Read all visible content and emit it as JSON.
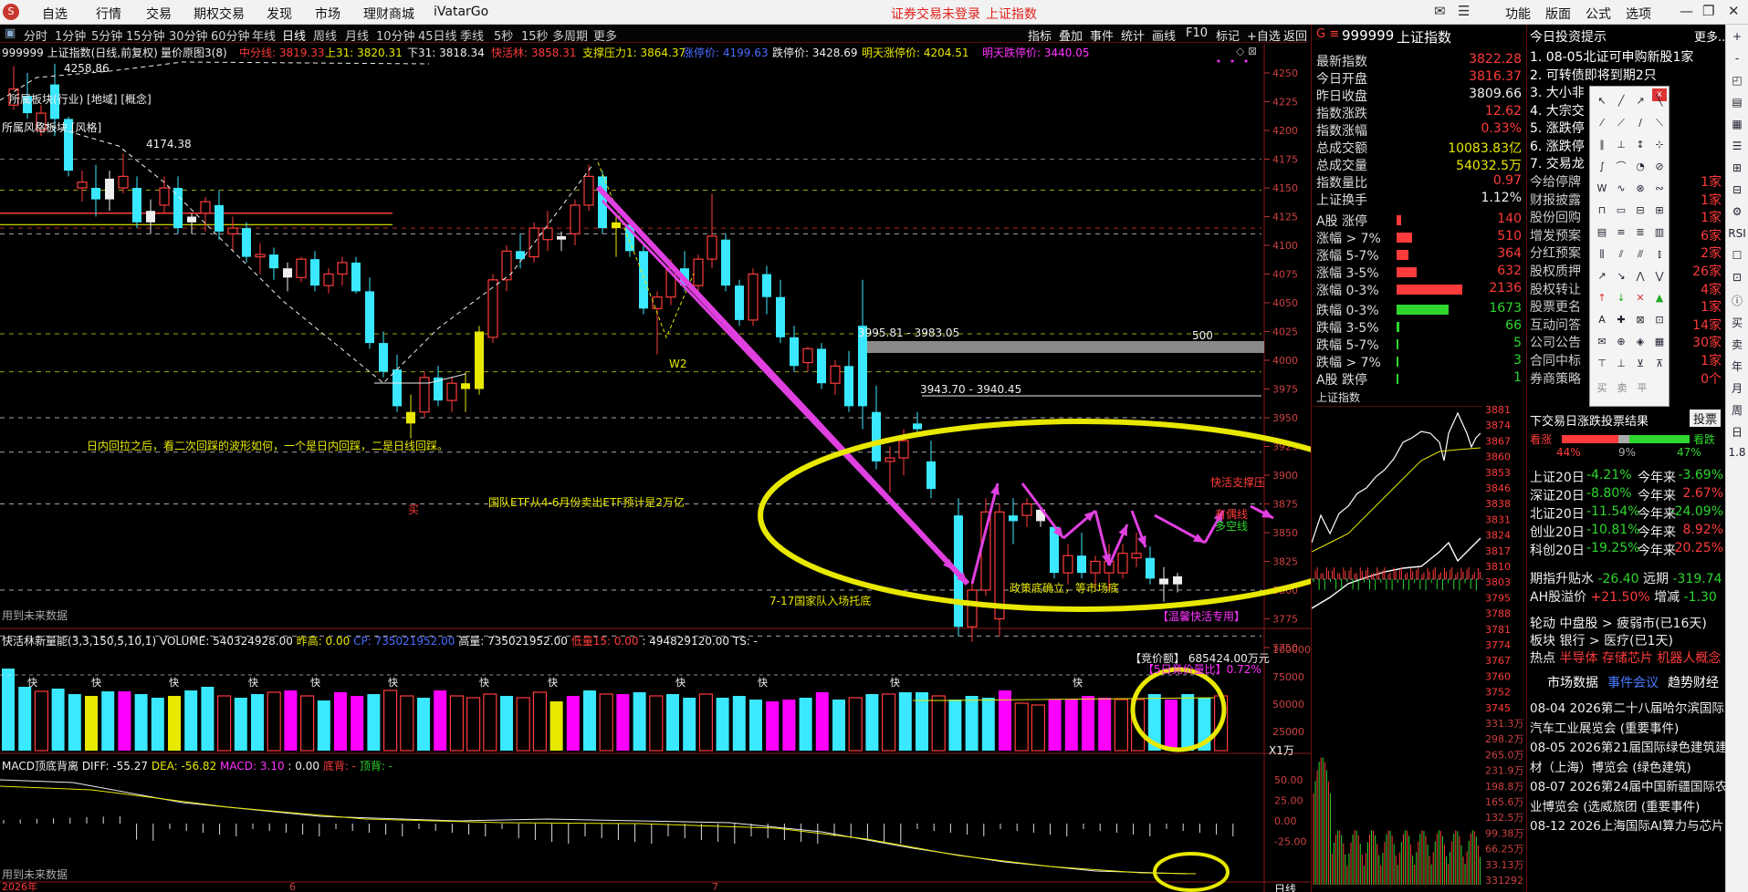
{
  "menu": {
    "items": [
      "自选",
      "行情",
      "交易",
      "期权交易",
      "发现",
      "市场",
      "理财商城",
      "iVatarGo"
    ],
    "notice": "证券交易未登录",
    "index_name": "上证指数",
    "right_items": [
      "功能",
      "版面",
      "公式",
      "选项"
    ]
  },
  "periods": {
    "items": [
      "分时",
      "1分钟",
      "5分钟",
      "15分钟",
      "30分钟",
      "60分钟",
      "年线",
      "日线",
      "周线",
      "月线",
      "10分钟",
      "45日线",
      "季线",
      "5秒",
      "15秒",
      "多周期",
      "更多"
    ],
    "selected": "日线"
  },
  "tools": {
    "items": [
      "指标",
      "叠加",
      "事件",
      "统计",
      "画线",
      "F10",
      "标记",
      "+自选",
      "返回"
    ]
  },
  "infobar": {
    "symbol": "999999 上证指数(日线,前复权)",
    "mode": "量价原图3(8)",
    "items": [
      {
        "label": "中分线: 3819.33",
        "color": "red"
      },
      {
        "label": "上31: 3820.31",
        "color": "yellow"
      },
      {
        "label": "下31: 3818.34",
        "color": "white"
      },
      {
        "label": "快活林: 3858.31",
        "color": "red"
      },
      {
        "label": "支撑压力1: 3864.37",
        "color": "yellow"
      },
      {
        "label": "涨停价: 4199.63",
        "color": "blue"
      },
      {
        "label": "跌停价: 3428.69",
        "color": "white"
      },
      {
        "label": "明天涨停价: 4204.51",
        "color": "yellow"
      },
      {
        "label": "明天跌停价: 3440.05",
        "color": "magenta"
      }
    ]
  },
  "colors": {
    "up": "#ff3b3b",
    "down": "#3ae8ff",
    "white": "#eeeeee",
    "yellow": "#e8e800",
    "magenta": "#ff33ff",
    "ellipse": "#e8e800",
    "arrow": "#e040e0",
    "grid": "#8a1a1a"
  },
  "chart": {
    "price_axis": [
      "4250",
      "4225",
      "4200",
      "4175",
      "4150",
      "4125",
      "4100",
      "4075",
      "4050",
      "4025",
      "4000",
      "3975",
      "3950",
      "3925",
      "3900",
      "3875",
      "3850",
      "3825",
      "3800",
      "3775",
      "3750"
    ],
    "high_label": "4258.86",
    "peak_label": "4174.38",
    "levels": [
      {
        "label": "3995.81 - 3983.05"
      },
      {
        "label": "3943.70 - 3940.45"
      },
      {
        "label": "500"
      }
    ],
    "annotations": {
      "w2": "W2",
      "note1": "日内回拉之后，看二次回踩的波形如何，一个是日内回踩，二是日线回踩。",
      "buy": "买",
      "note2": "国队ETF从4-6月份卖出ETF预计是2万亿",
      "note3": "7-17国家队入场托底",
      "note4": "政策底确立，等市场底",
      "r1": "快活支撑压",
      "r2": "多空线",
      "r3": "有偶线",
      "r4": "【温馨快活专用】",
      "tag1": "所属板块(行业) [地域] [概念]",
      "tag2": "所属风格板块 [风格]",
      "future": "用到未来数据"
    }
  },
  "volume": {
    "header": "快活林新量能(3,3,150,5,10,1) VOLUME: 540324928.00",
    "items": [
      {
        "label": "昨高: 0.00",
        "color": "yellow"
      },
      {
        "label": "CP: 735021952.00",
        "color": "blue"
      },
      {
        "label": "高量: 735021952.00",
        "color": "white"
      },
      {
        "label": "低量15: 0.00",
        "color": "red"
      },
      {
        "label": ": 494829120.00 TS: -",
        "color": "white"
      }
    ],
    "axis": [
      "100000",
      "75000",
      "50000",
      "25000"
    ],
    "unit": "X1万",
    "bid": "【竞价额】 685424.00万元",
    "bid_ratio": "【5日竞价量比】0.72%",
    "label_k": "快"
  },
  "macd": {
    "header": "MACD顶底背离",
    "diff": "DIFF: -55.27",
    "dea": "DEA: -56.82",
    "macd": "MACD: 3.10",
    "extra": ": 0.00",
    "bottom": "底背: -",
    "top": "顶背: -",
    "axis": [
      "50.00",
      "25.00",
      "0.00",
      "-25.00"
    ],
    "future": "用到未来数据"
  },
  "xaxis": {
    "labels": [
      "2026年",
      "6",
      "7"
    ],
    "unit": "日线"
  },
  "quote": {
    "code": "999999",
    "name": "上证指数",
    "rows": [
      {
        "label": "最新指数",
        "value": "3822.28",
        "color": "red"
      },
      {
        "label": "今日开盘",
        "value": "3816.37",
        "color": "red"
      },
      {
        "label": "昨日收盘",
        "value": "3809.66",
        "color": "white"
      },
      {
        "label": "指数涨跌",
        "value": "12.62",
        "color": "red"
      },
      {
        "label": "指数涨幅",
        "value": "0.33%",
        "color": "red"
      },
      {
        "label": "总成交额",
        "value": "10083.83亿",
        "color": "yellow"
      },
      {
        "label": "总成交量",
        "value": "54032.5万",
        "color": "yellow"
      },
      {
        "label": "指数量比",
        "value": "0.97",
        "color": "red"
      },
      {
        "label": "上证换手",
        "value": "1.12%",
        "color": "white"
      }
    ]
  },
  "breadth": {
    "rows": [
      {
        "label": "A股 涨停",
        "value": "140",
        "bar": 0.05,
        "type": "up"
      },
      {
        "label": "涨幅 > 7%",
        "value": "510",
        "bar": 0.19,
        "type": "up"
      },
      {
        "label": "涨幅 5-7%",
        "value": "364",
        "bar": 0.14,
        "type": "up"
      },
      {
        "label": "涨幅 3-5%",
        "value": "632",
        "bar": 0.24,
        "type": "up"
      },
      {
        "label": "涨幅 0-3%",
        "value": "2136",
        "bar": 0.8,
        "type": "up"
      },
      {
        "label": "跌幅 0-3%",
        "value": "1673",
        "bar": 0.63,
        "type": "down"
      },
      {
        "label": "跌幅 3-5%",
        "value": "66",
        "bar": 0.03,
        "type": "down"
      },
      {
        "label": "跌幅 5-7%",
        "value": "5",
        "bar": 0.01,
        "type": "down"
      },
      {
        "label": "跌幅 > 7%",
        "value": "3",
        "bar": 0.01,
        "type": "down"
      },
      {
        "label": "A股 跌停",
        "value": "1",
        "bar": 0.005,
        "type": "down"
      }
    ]
  },
  "mini": {
    "title": "上证指数",
    "axis": [
      "3881",
      "3874",
      "3867",
      "3860",
      "3853",
      "3846",
      "3838",
      "3831",
      "3824",
      "3817",
      "3810",
      "3803",
      "3795",
      "3788",
      "3781",
      "3774",
      "3767",
      "3760",
      "3752",
      "3745",
      "331.3万",
      "298.2万",
      "265.0万",
      "231.9万",
      "198.8万",
      "165.6万",
      "132.5万",
      "99.38万",
      "66.25万",
      "33.13万",
      "331292"
    ]
  },
  "tips": {
    "title": "今日投资提示",
    "more": "更多..",
    "items": [
      "1. 08-05北证可申购新股1家",
      "2. 可转债即将到期2只",
      "3. 大小非",
      "4. 大宗交",
      "5. 涨跌停",
      "6. 涨跌停",
      "7. 交易龙"
    ],
    "stats": [
      {
        "label": "今给停牌",
        "value": "1家"
      },
      {
        "label": "财报披露",
        "value": "1家"
      },
      {
        "label": "股份回购",
        "value": "1家"
      },
      {
        "label": "增发预案",
        "value": "6家"
      },
      {
        "label": "分红预案",
        "value": "2家"
      },
      {
        "label": "股权质押",
        "value": "26家"
      },
      {
        "label": "股权转让",
        "value": "4家"
      },
      {
        "label": "股票更名",
        "value": "1家"
      },
      {
        "label": "互动问答",
        "value": "14家"
      },
      {
        "label": "公司公告",
        "value": "30家"
      },
      {
        "label": "合同中标",
        "value": "1家"
      },
      {
        "label": "券商策略",
        "value": "0个"
      }
    ]
  },
  "vote": {
    "title": "下交易日涨跌投票结果",
    "btn": "投票",
    "bull": "看涨",
    "bear": "看跌",
    "bull_pct": "44%",
    "mid_pct": "9%",
    "bear_pct": "47%"
  },
  "perf": [
    {
      "n": "上证20日",
      "a": "-4.21%",
      "b": "今年来",
      "c": "-3.69%"
    },
    {
      "n": "深证20日",
      "a": "-8.80%",
      "b": "今年来",
      "c": "2.67%"
    },
    {
      "n": "北证20日",
      "a": "-11.54%",
      "b": "今年来",
      "c": "-24.09%"
    },
    {
      "n": "创业20日",
      "a": "-10.81%",
      "b": "今年来",
      "c": "8.92%"
    },
    {
      "n": "科创20日",
      "a": "-19.25%",
      "b": "今年来",
      "c": "20.25%"
    }
  ],
  "premium": {
    "l1": "期指升贴水",
    "v1": "-26.40",
    "l2": "远期",
    "v2": "-319.74",
    "l3": "AH股溢价",
    "v3": "+21.50%",
    "l4": "增减",
    "v4": "-1.30"
  },
  "rotation": {
    "l1": "轮动",
    "v1": "中盘股 > 疲弱市(已16天)",
    "l2": "板块",
    "v2": "银行 > 医疗(已1天)",
    "l3": "热点",
    "v3": "半导体 存储芯片 机器人概念"
  },
  "events": {
    "tabs": [
      "市场数据",
      "事件会议",
      "趋势财经"
    ],
    "items": [
      "08-04 2026第二十八届哈尔滨国际",
      "汽车工业展览会 (重要事件)",
      "08-05 2026第21届国际绿色建筑建",
      "材（上海）博览会 (绿色建筑)",
      "08-07 2026第24届中国新疆国际农",
      "业博览会 (选威旅团 (重要事件)",
      "08-12 2026上海国际AI算力与芯片"
    ]
  },
  "toolbox": {
    "close": "x",
    "labels": [
      "买",
      "卖",
      "平"
    ]
  },
  "vtool": [
    "+",
    "-",
    "◰",
    "▤",
    "▦",
    "☰",
    "⊞",
    "⊟",
    "⚙",
    "RSI",
    "☐",
    "⊡",
    "ⓘ",
    "买",
    "卖",
    "年",
    "月",
    "周",
    "日",
    "1.8"
  ]
}
